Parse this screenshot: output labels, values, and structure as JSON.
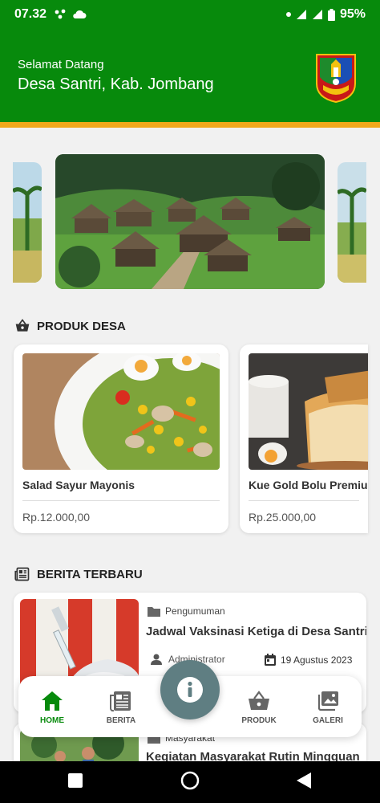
{
  "status_bar": {
    "time": "07.32",
    "battery": "95%"
  },
  "header": {
    "greeting": "Selamat Datang",
    "village": "Desa Santri, Kab. Jombang"
  },
  "colors": {
    "primary_green": "#078a0c",
    "accent_gold": "#f0a81c",
    "fab": "#5f7e82"
  },
  "sections": {
    "produk": "PRODUK DESA",
    "berita": "BERITA TERBARU"
  },
  "products": [
    {
      "name": "Salad Sayur Mayonis",
      "price": "Rp.12.000,00"
    },
    {
      "name": "Kue Gold Bolu Premium",
      "price": "Rp.25.000,00"
    }
  ],
  "news": [
    {
      "category": "Pengumuman",
      "title": "Jadwal Vaksinasi Ketiga di Desa Santri",
      "author": "Administrator",
      "date": "19 Agustus 2023"
    },
    {
      "category": "Masyarakat",
      "title": "Kegiatan Masyarakat Rutin Mingguan"
    }
  ],
  "bottom_nav": {
    "home": "HOME",
    "berita": "BERITA",
    "produk": "PRODUK",
    "galeri": "GALERI"
  }
}
